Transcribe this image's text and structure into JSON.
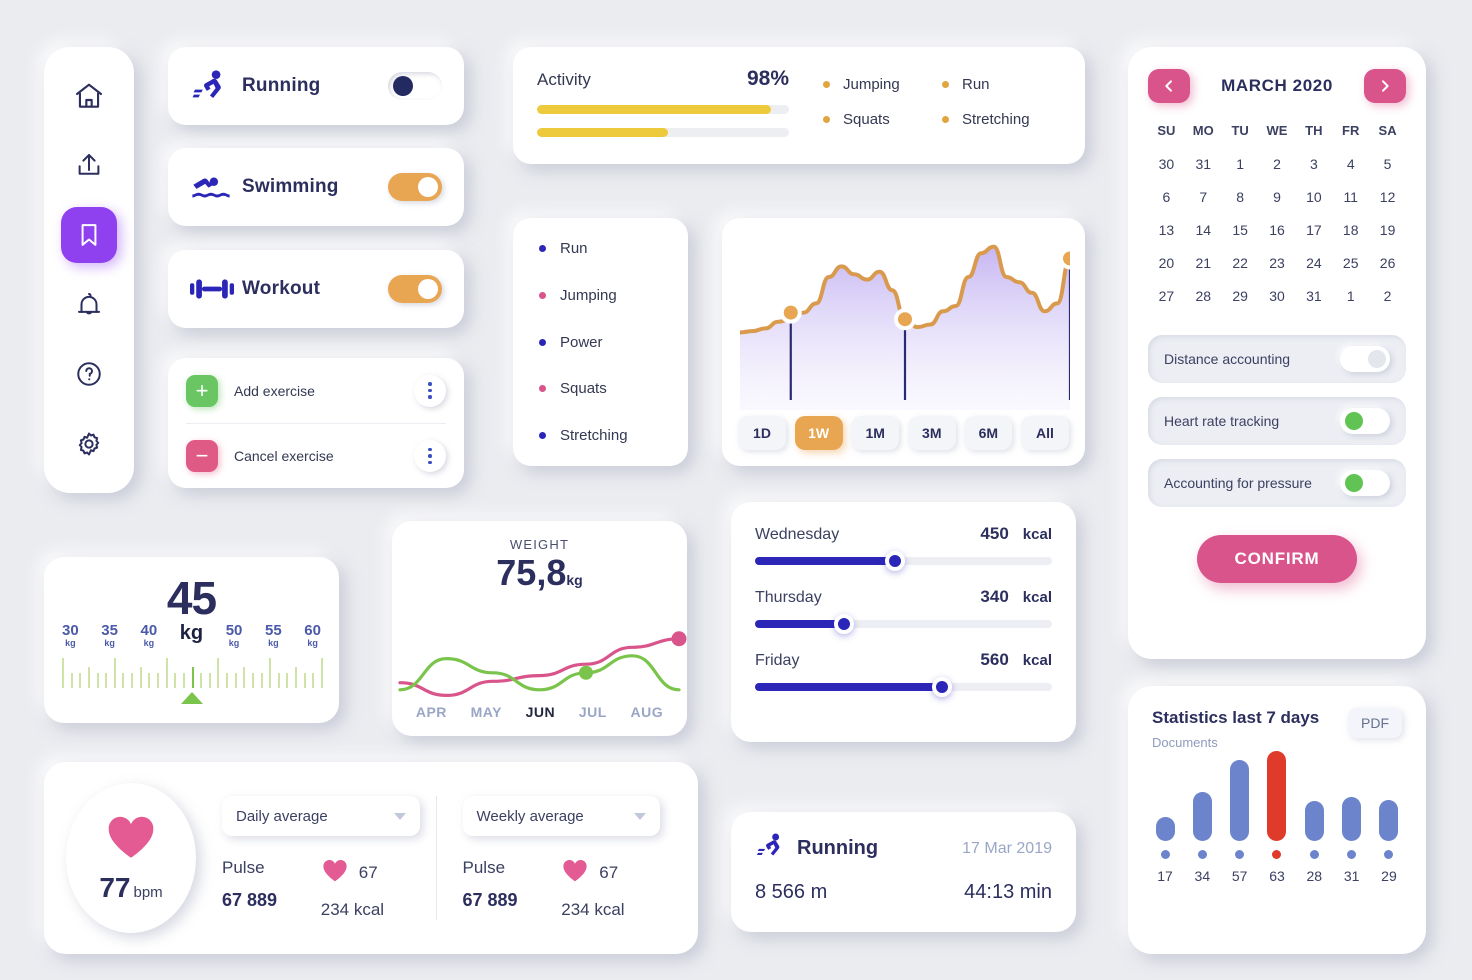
{
  "sidebar": {
    "items": [
      {
        "icon": "home-icon",
        "name": "home",
        "active": false
      },
      {
        "icon": "upload-icon",
        "name": "upload",
        "active": false
      },
      {
        "icon": "bookmark-icon",
        "name": "bookmark",
        "active": true
      },
      {
        "icon": "bell-icon",
        "name": "notifications",
        "active": false
      },
      {
        "icon": "help-icon",
        "name": "help",
        "active": false
      },
      {
        "icon": "gear-icon",
        "name": "settings",
        "active": false
      }
    ],
    "active_color": "#8f40ef"
  },
  "activities": [
    {
      "label": "Running",
      "icon": "running-icon",
      "on": false
    },
    {
      "label": "Swimming",
      "icon": "swimming-icon",
      "on": true
    },
    {
      "label": "Workout",
      "icon": "dumbbell-icon",
      "on": true
    }
  ],
  "exercise": {
    "rows": [
      {
        "label": "Add exercise",
        "badge": "+",
        "color": "#69c663"
      },
      {
        "label": "Cancel exercise",
        "badge": "−",
        "color": "#e05a86"
      }
    ]
  },
  "activity_panel": {
    "title": "Activity",
    "percent": "98%",
    "bars": [
      93,
      52
    ],
    "bar_color": "#ecca3c",
    "legend": [
      "Jumping",
      "Run",
      "Squats",
      "Stretching"
    ],
    "legend_dot_color": "#e0a53f"
  },
  "legend_list": [
    {
      "label": "Run",
      "color": "#2c26b8"
    },
    {
      "label": "Jumping",
      "color": "#d9548a"
    },
    {
      "label": "Power",
      "color": "#2c26b8"
    },
    {
      "label": "Squats",
      "color": "#d9548a"
    },
    {
      "label": "Stretching",
      "color": "#2c26b8"
    }
  ],
  "chart_data": {
    "type": "area",
    "title": "",
    "line_color": "#d99a4e",
    "fill_color": "#cfc2f5",
    "marker_color": "#e8a552",
    "x": [
      0,
      1,
      2,
      3,
      4,
      5,
      6,
      7,
      8,
      9,
      10,
      11,
      12,
      13,
      14,
      15,
      16,
      17,
      18,
      19,
      20,
      21,
      22,
      23,
      24
    ],
    "values": [
      30,
      31,
      33,
      38,
      40,
      45,
      52,
      72,
      80,
      74,
      70,
      76,
      62,
      40,
      34,
      36,
      46,
      50,
      72,
      90,
      95,
      72,
      68,
      60,
      46,
      52,
      86
    ],
    "markers": [
      {
        "x": 4,
        "y": 45
      },
      {
        "x": 13,
        "y": 40
      },
      {
        "x": 26,
        "y": 86
      }
    ],
    "ylim": [
      0,
      100
    ],
    "grid": false,
    "ranges": [
      "1D",
      "1W",
      "1M",
      "3M",
      "6M",
      "All"
    ],
    "active_range": "1W"
  },
  "scale": {
    "value": "45",
    "unit": "kg",
    "ticks": [
      {
        "v": "30",
        "u": "kg"
      },
      {
        "v": "35",
        "u": "kg"
      },
      {
        "v": "40",
        "u": "kg"
      },
      {
        "v": "50",
        "u": "kg"
      },
      {
        "v": "55",
        "u": "kg"
      },
      {
        "v": "60",
        "u": "kg"
      }
    ]
  },
  "weight_chart": {
    "type": "line",
    "title": "WEIGHT",
    "value": "75,8",
    "unit": "kg",
    "categories": [
      "APR",
      "MAY",
      "JUN",
      "JUL",
      "AUG"
    ],
    "active_month": "JUN",
    "series": [
      {
        "name": "pink",
        "color": "#d9548a",
        "values": [
          45,
          36,
          46,
          50,
          58,
          70,
          76
        ],
        "marker_index": 6
      },
      {
        "name": "green",
        "color": "#7bc44c",
        "values": [
          40,
          62,
          52,
          40,
          52,
          64,
          40
        ],
        "marker_index": 4
      }
    ]
  },
  "kcal": {
    "unit": "kcal",
    "rows": [
      {
        "day": "Wednesday",
        "value": "450",
        "pct": 47
      },
      {
        "day": "Thursday",
        "value": "340",
        "pct": 30
      },
      {
        "day": "Friday",
        "value": "560",
        "pct": 63
      }
    ]
  },
  "run_summary": {
    "icon": "running-icon",
    "name": "Running",
    "date": "17 Mar 2019",
    "distance": "8 566 m",
    "duration": "44:13 min"
  },
  "pulse_panel": {
    "bpm_value": "77",
    "bpm_unit": "bpm",
    "columns": [
      {
        "select": "Daily average",
        "pulse_label": "Pulse",
        "pulse_value": "67 889",
        "hr_value": "67",
        "kcal": "234 kcal"
      },
      {
        "select": "Weekly average",
        "pulse_label": "Pulse",
        "pulse_value": "67 889",
        "hr_value": "67",
        "kcal": "234 kcal"
      }
    ]
  },
  "calendar": {
    "title": "MARCH 2020",
    "dows": [
      "SU",
      "MO",
      "TU",
      "WE",
      "TH",
      "FR",
      "SA"
    ],
    "days": [
      "30",
      "31",
      "1",
      "2",
      "3",
      "4",
      "5",
      "6",
      "7",
      "8",
      "9",
      "10",
      "11",
      "12",
      "13",
      "14",
      "15",
      "16",
      "17",
      "18",
      "19",
      "20",
      "21",
      "22",
      "23",
      "24",
      "25",
      "26",
      "27",
      "28",
      "29",
      "30",
      "31",
      "1",
      "2"
    ],
    "toggles": [
      {
        "label": "Distance accounting",
        "on": false
      },
      {
        "label": "Heart rate tracking",
        "on": true
      },
      {
        "label": "Accounting for pressure",
        "on": true
      }
    ],
    "confirm_label": "CONFIRM",
    "accent": "#d9548a"
  },
  "statistics": {
    "chart_data": {
      "type": "bar",
      "title": "Statistics last 7 days",
      "subtitle": "Documents",
      "categories": [
        "17",
        "34",
        "57",
        "63",
        "28",
        "31",
        "29"
      ],
      "values": [
        17,
        34,
        57,
        63,
        28,
        31,
        29
      ],
      "highlight_index": 3,
      "bar_color": "#6b84cb",
      "highlight_color": "#e03a2a",
      "ylim": [
        0,
        70
      ]
    },
    "pdf_label": "PDF"
  }
}
